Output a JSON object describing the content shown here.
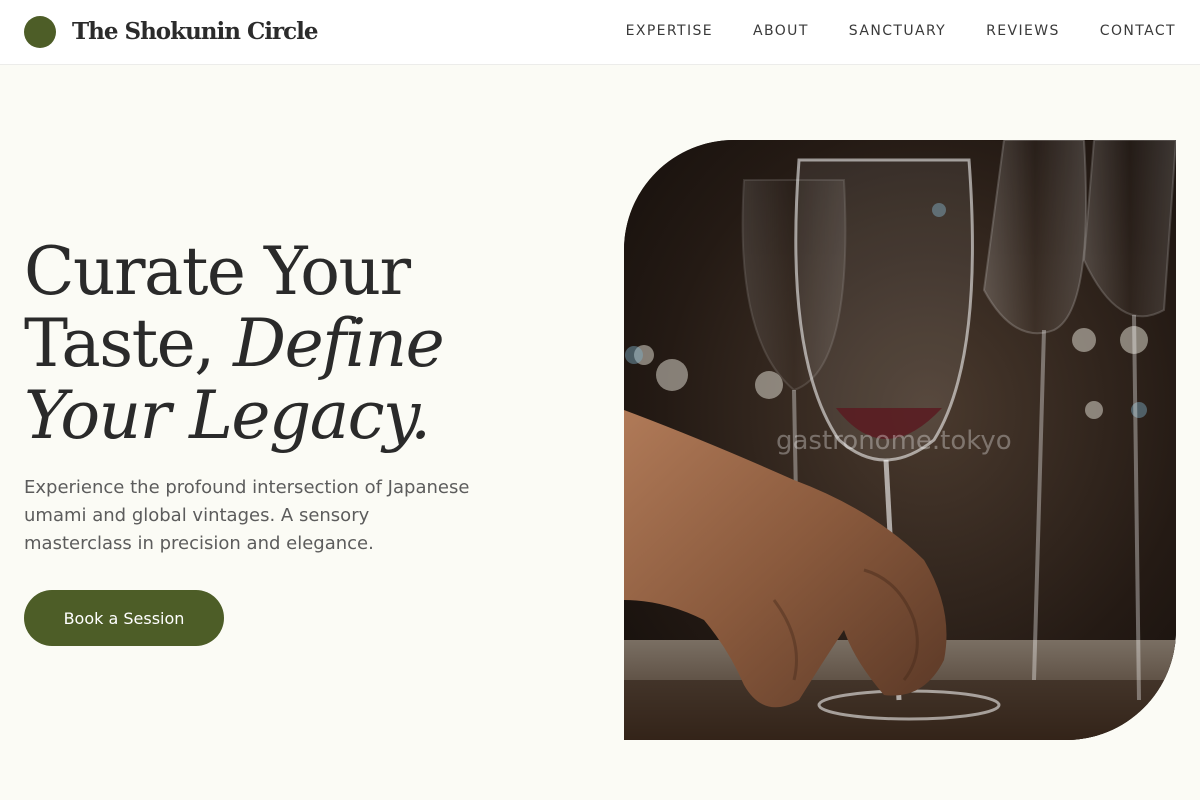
{
  "header": {
    "brand": "The Shokunin Circle",
    "nav": [
      "EXPERTISE",
      "ABOUT",
      "SANCTUARY",
      "REVIEWS",
      "CONTACT"
    ]
  },
  "hero": {
    "title_line1": "Curate Your",
    "title_line2_plain": "Taste, ",
    "title_line2_italic": "Define",
    "title_line3_italic": "Your Legacy.",
    "subtitle": "Experience the profound intersection of Japanese umami and global vintages. A sensory masterclass in precision and elegance.",
    "cta_label": "Book a Session"
  },
  "image": {
    "watermark": "gastronome.tokyo"
  },
  "colors": {
    "accent": "#4d5d27",
    "background": "#fbfbf5",
    "text": "#2a2a2a"
  }
}
